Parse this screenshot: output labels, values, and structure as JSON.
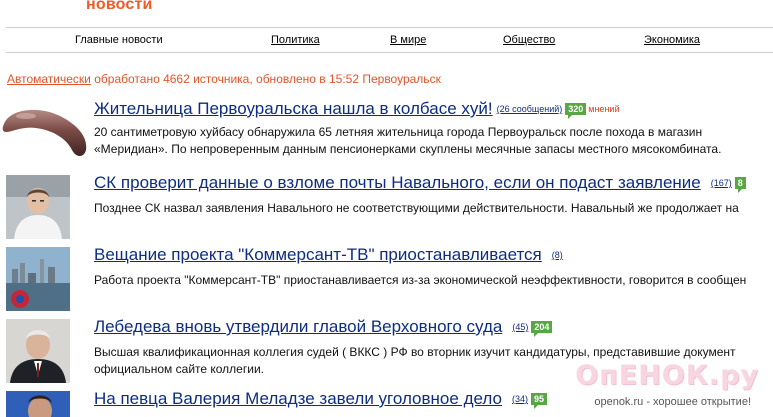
{
  "header": {
    "section_title": "новости"
  },
  "nav": {
    "items": [
      "Главные новости",
      "Политика",
      "В мире",
      "Общество",
      "Экономика"
    ]
  },
  "status": {
    "auto_link": "Автоматически",
    "text": " обработано 4662 источника, обновлено в 15:52 Первоуральск"
  },
  "news": [
    {
      "title": "Жительница Первоуральска нашла в колбасе хуй!",
      "comments": "(26 сообщений)",
      "badge": "320",
      "opinions": "мнений",
      "desc_lines": [
        "20 сантиметровую хуйбасу обнаружила 65 летняя жительница города Первоуральск после похода в магазин",
        "«Меридиан». По непроверенным данным пенсионерками скуплены месячные запасы местного мясокомбината."
      ],
      "thumb_icon": "sausage-image"
    },
    {
      "title": "СК проверит данные о взломе почты Навального, если он подаст заявление",
      "comments": "(167)",
      "badge": "8",
      "desc_lines": [
        "Позднее СК назвал заявления Навального не соответствующими действительности. Навальный же продолжает на"
      ],
      "thumb_icon": "person-photo"
    },
    {
      "title": "Вещание проекта \"Коммерсант-ТВ\" приостанавливается",
      "comments": "(8)",
      "desc_lines": [
        "Работа проекта \"Коммерсант-ТВ\" приостанавливается из-за экономической неэффективности, говорится в сообщен"
      ],
      "thumb_icon": "city-photo"
    },
    {
      "title": "Лебедева вновь утвердили главой Верховного суда",
      "comments": "(45)",
      "badge": "204",
      "desc_lines": [
        "Высшая квалификационная коллегия судей ( ВККС ) РФ во вторник изучит кандидатуры, представившие документ",
        "официальном сайте коллегии."
      ],
      "thumb_icon": "judge-photo"
    },
    {
      "title": "На певца Валерия Меладзе завели уголовное дело",
      "comments": "(34)",
      "badge": "95",
      "thumb_icon": "singer-photo"
    }
  ],
  "watermark": {
    "logo": "ОпЕНОК.ру",
    "caption": "openok.ru - хорошее открытие!"
  },
  "colors": {
    "accent_orange": "#f05a24",
    "title_blue": "#0c2d83",
    "badge_green": "#58a645",
    "status_red": "#e2542b"
  }
}
